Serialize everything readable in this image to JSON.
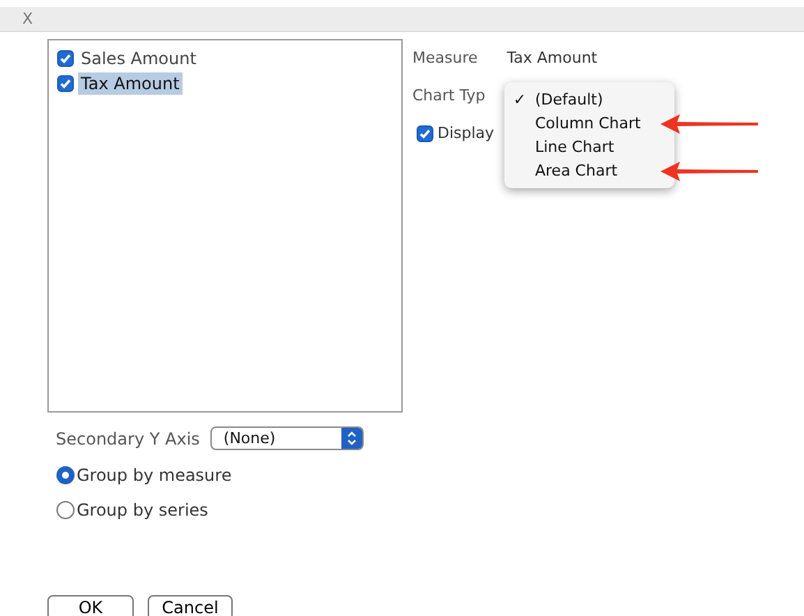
{
  "header": {
    "close": "X"
  },
  "measures": [
    {
      "label": "Sales Amount",
      "checked": true,
      "selected": false
    },
    {
      "label": "Tax Amount",
      "checked": true,
      "selected": true
    }
  ],
  "measure": {
    "label": "Measure",
    "value": "Tax Amount"
  },
  "chart_type": {
    "label": "Chart Typ",
    "menu": [
      {
        "label": "(Default)",
        "checked": true,
        "marked": false
      },
      {
        "label": "Column Chart",
        "checked": false,
        "marked": true
      },
      {
        "label": "Line Chart",
        "checked": false,
        "marked": false
      },
      {
        "label": "Area Chart",
        "checked": false,
        "marked": true
      }
    ],
    "check_mark": "✓"
  },
  "display": {
    "label": "Display",
    "checked": true
  },
  "secondary_y_axis": {
    "label": "Secondary Y Axis",
    "value": "(None)"
  },
  "grouping": [
    {
      "label": "Group by measure",
      "selected": true
    },
    {
      "label": "Group by series",
      "selected": false
    }
  ],
  "buttons": [
    "OK",
    "Cancel"
  ]
}
